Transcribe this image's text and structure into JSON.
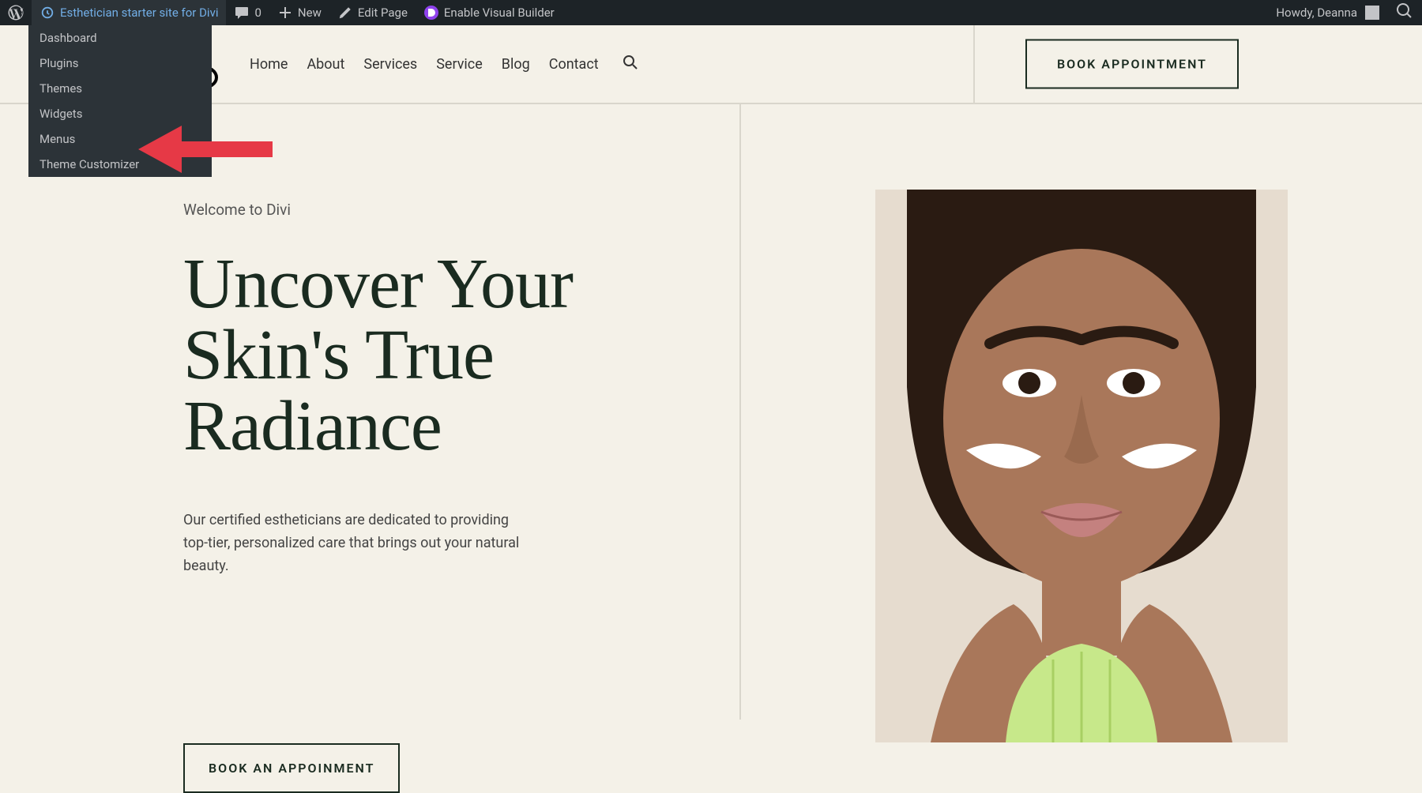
{
  "adminbar": {
    "site_name": "Esthetician starter site for Divi",
    "comments_count": "0",
    "new_label": "New",
    "edit_page_label": "Edit Page",
    "visual_builder_label": "Enable Visual Builder",
    "howdy": "Howdy, Deanna"
  },
  "dropdown": {
    "items": [
      "Dashboard",
      "Plugins",
      "Themes",
      "Widgets",
      "Menus",
      "Theme Customizer"
    ]
  },
  "nav": {
    "items": [
      "Home",
      "About",
      "Services",
      "Service",
      "Blog",
      "Contact"
    ]
  },
  "header_cta": "BOOK APPOINTMENT",
  "hero": {
    "welcome": "Welcome to Divi",
    "title": "Uncover Your Skin's True Radiance",
    "desc": "Our certified estheticians are dedicated to providing top-tier, personalized care that brings out your natural beauty.",
    "cta": "BOOK AN APPOINMENT"
  },
  "colors": {
    "accent": "#1a2b20",
    "bg": "#f4f1e8",
    "adminbar": "#1d2327",
    "dropdown": "#2c3338",
    "arrow": "#e63946"
  }
}
